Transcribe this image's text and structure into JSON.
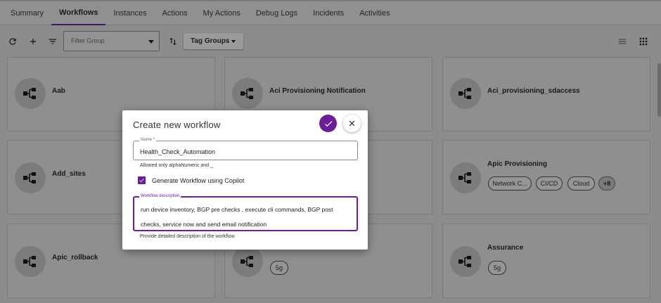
{
  "tabs": [
    {
      "label": "Summary",
      "active": false
    },
    {
      "label": "Workflows",
      "active": true
    },
    {
      "label": "Instances",
      "active": false
    },
    {
      "label": "Actions",
      "active": false
    },
    {
      "label": "My Actions",
      "active": false
    },
    {
      "label": "Debug Logs",
      "active": false
    },
    {
      "label": "Incidents",
      "active": false
    },
    {
      "label": "Activities",
      "active": false
    }
  ],
  "toolbar": {
    "filter_group_placeholder": "Filter Group",
    "tag_groups_label": "Tag Groups",
    "icons": [
      "refresh-icon",
      "add-icon",
      "filter-icon",
      "sort-icon",
      "list-view-icon",
      "grid-view-icon"
    ]
  },
  "cards": [
    {
      "title": "Aab",
      "chips": []
    },
    {
      "title": "Aci Provisioning Notification",
      "chips": []
    },
    {
      "title": "Aci_provisioning_sdaccess",
      "chips": []
    },
    {
      "title": "Add_sites",
      "chips": []
    },
    {
      "title": "",
      "chips": []
    },
    {
      "title": "Apic Provisioning",
      "chips": [
        "Network C...",
        "CI/CD",
        "Cloud",
        "+8"
      ]
    },
    {
      "title": "Apic_rollback",
      "chips": []
    },
    {
      "title": "",
      "chips": [
        "5g"
      ]
    },
    {
      "title": "Assurance",
      "chips": [
        "5g"
      ]
    }
  ],
  "modal": {
    "title": "Create new workflow",
    "name_label": "Name *",
    "name_value": "Health_Check_Automation",
    "name_hint": "Allowed only alphaNumeric and _",
    "copilot_label": "Generate Workflow using Copilot",
    "copilot_checked": true,
    "description_label": "Workflow description",
    "description_value": "run device inventory, BGP pre checks , execute cli commands, BGP post checks, service now and send email notification",
    "description_hint": "Provide detailed description of the workflow"
  },
  "colors": {
    "accent": "#6a1f95",
    "overlay": "#8c8c8c"
  }
}
